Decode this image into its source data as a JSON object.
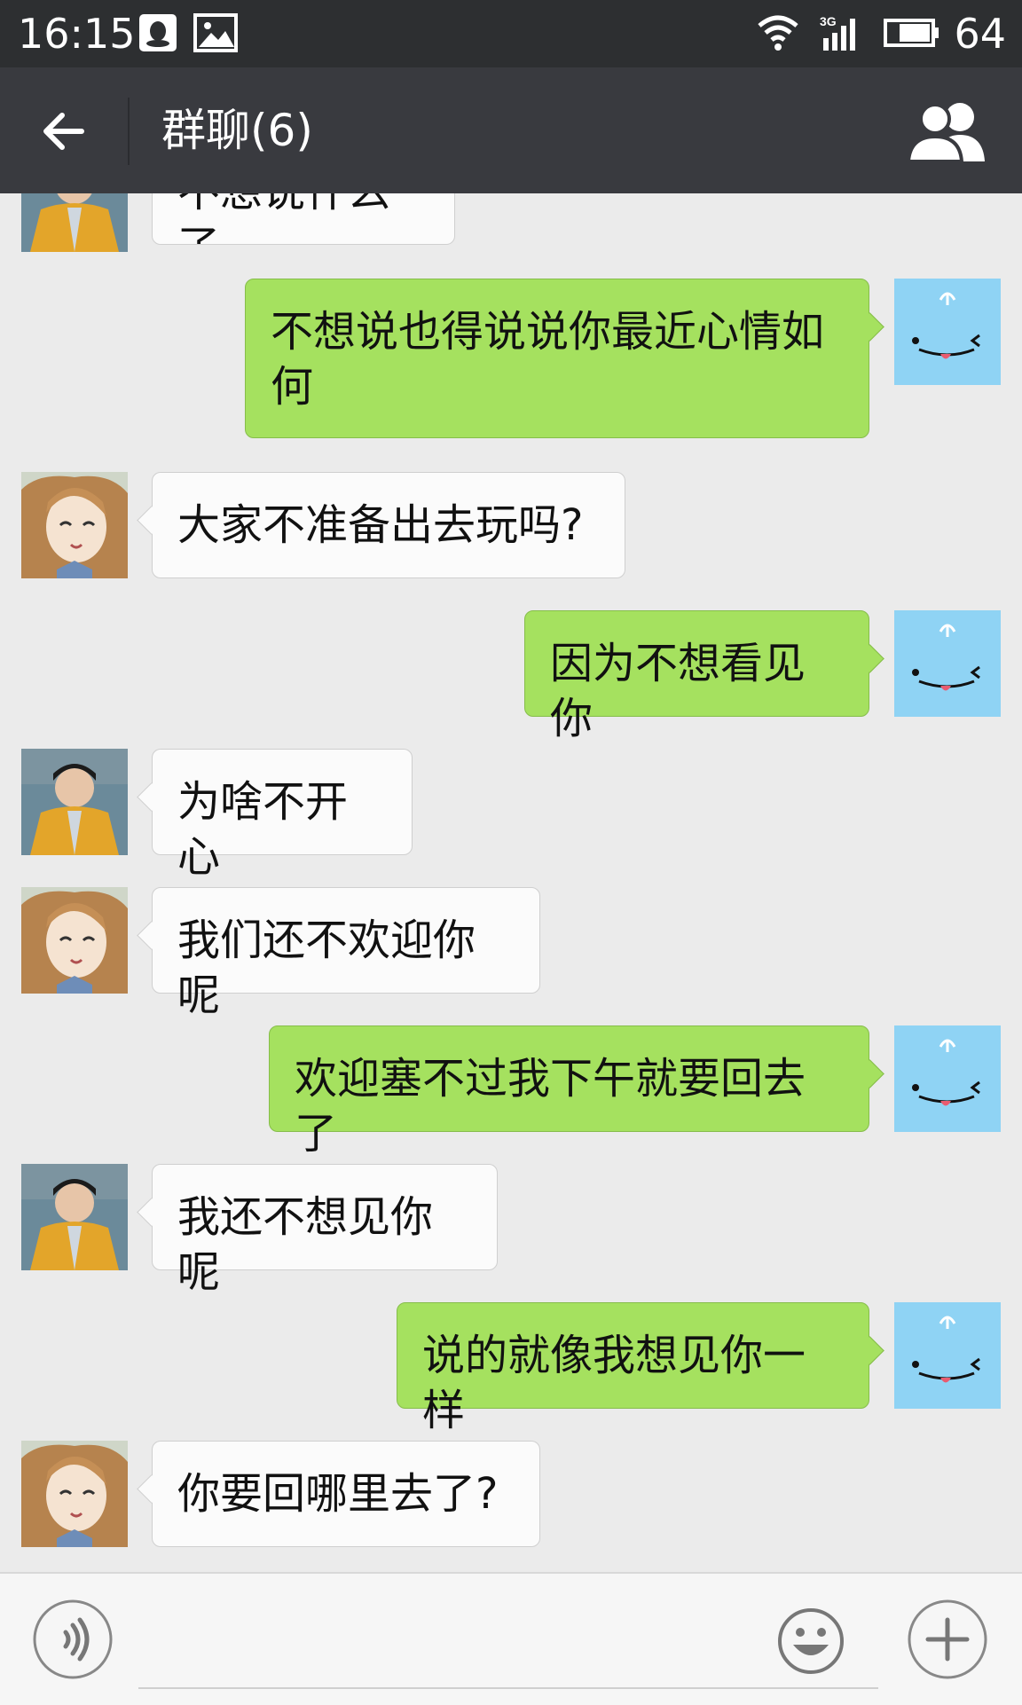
{
  "status_bar": {
    "time": "16:15",
    "network": "3G",
    "battery": "64"
  },
  "header": {
    "title": "群聊(6)"
  },
  "messages": [
    {
      "side": "in",
      "avatar": "girl-yellow-jacket",
      "text": "不想说什么了"
    },
    {
      "side": "out",
      "avatar": "blue-face",
      "text": "不想说也得说说你最近心情如何"
    },
    {
      "side": "in",
      "avatar": "anime-girl",
      "text": "大家不准备出去玩吗?"
    },
    {
      "side": "out",
      "avatar": "blue-face",
      "text": "因为不想看见你"
    },
    {
      "side": "in",
      "avatar": "girl-yellow-jacket",
      "text": "为啥不开心"
    },
    {
      "side": "in",
      "avatar": "anime-girl",
      "text": "我们还不欢迎你呢"
    },
    {
      "side": "out",
      "avatar": "blue-face",
      "text": "欢迎塞不过我下午就要回去了"
    },
    {
      "side": "in",
      "avatar": "girl-yellow-jacket",
      "text": "我还不想见你呢"
    },
    {
      "side": "out",
      "avatar": "blue-face",
      "text": "说的就像我想见你一样"
    },
    {
      "side": "in",
      "avatar": "anime-girl",
      "text": "你要回哪里去了?"
    }
  ],
  "input_bar": {
    "message_value": ""
  }
}
